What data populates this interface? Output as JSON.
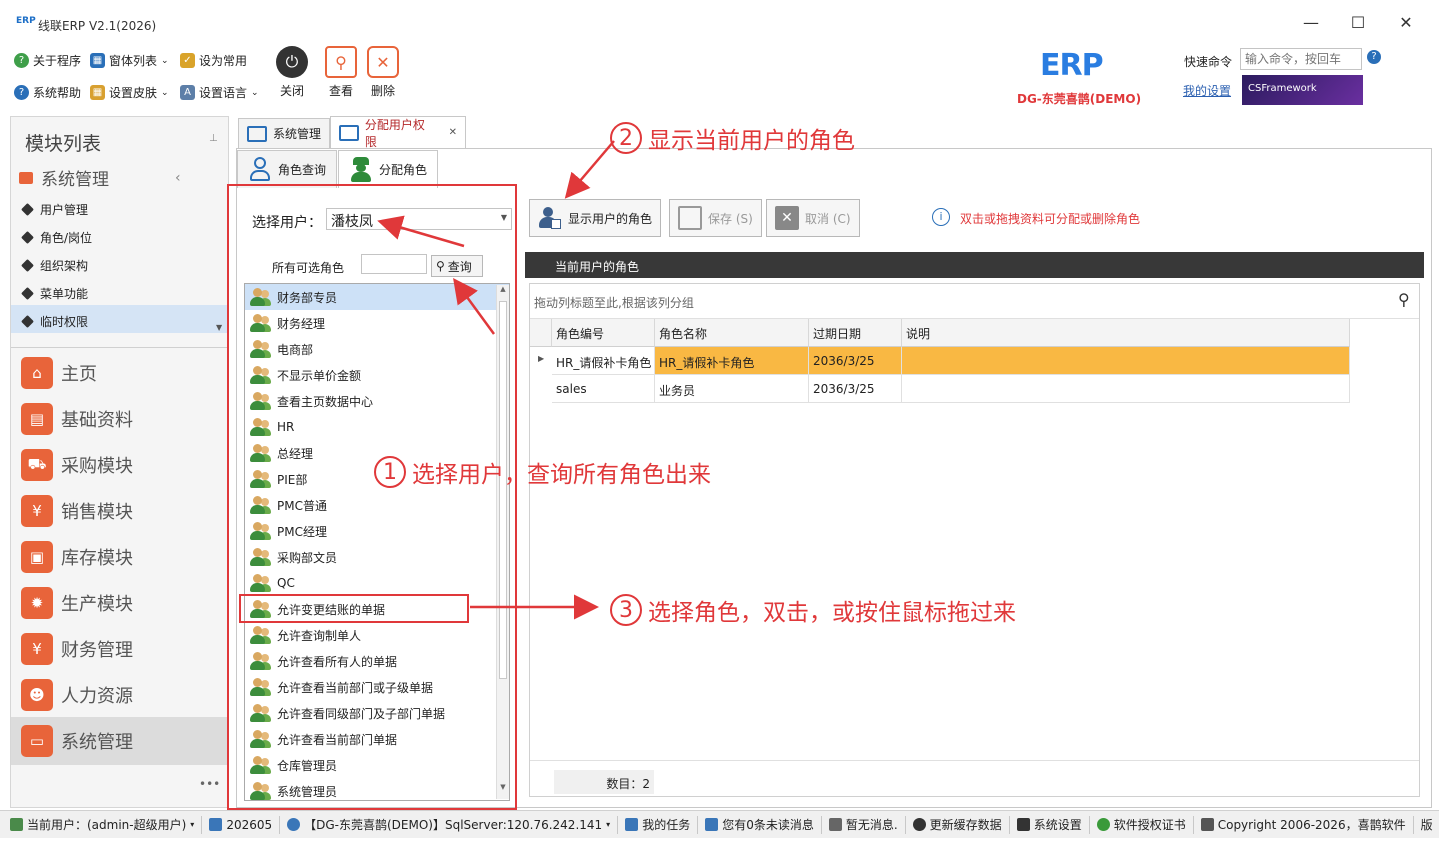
{
  "window": {
    "title": "线联ERP V2.1(2026)",
    "icon_text": "ERP",
    "min": "—",
    "max": "☐",
    "close": "✕"
  },
  "ribbon": {
    "small_items": [
      "关于程序",
      "窗体列表",
      "设为常用",
      "系统帮助",
      "设置皮肤",
      "设置语言"
    ],
    "big_buttons": [
      "关闭",
      "查看",
      "删除"
    ],
    "logo_text": "ERP",
    "company": "DG-东莞喜鹊(DEMO)",
    "quick_cmd_label": "快速命令",
    "quick_cmd_placeholder": "输入命令，按回车",
    "my_settings": "我的设置",
    "cs_framework": "CSFramework",
    "help_icon": "?"
  },
  "left_panel": {
    "title": "模块列表",
    "group": "系统管理",
    "sub_items": [
      "用户管理",
      "角色/岗位",
      "组织架构",
      "菜单功能",
      "临时权限"
    ],
    "modules": [
      "主页",
      "基础资料",
      "采购模块",
      "销售模块",
      "库存模块",
      "生产模块",
      "财务管理",
      "人力资源",
      "系统管理"
    ],
    "more": "•••"
  },
  "tabs": {
    "main": [
      "系统管理",
      "分配用户权限"
    ],
    "sub": [
      "角色查询",
      "分配角色"
    ],
    "close": "✕"
  },
  "role_panel": {
    "select_user_label": "选择用户：",
    "select_user_value": "潘枝凤",
    "all_roles_label": "所有可选角色",
    "search_button": "查询",
    "roles": [
      "财务部专员",
      "财务经理",
      "电商部",
      "不显示单价金额",
      "查看主页数据中心",
      "HR",
      "总经理",
      "PIE部",
      "PMC普通",
      "PMC经理",
      "采购部文员",
      "QC",
      "允许变更结账的单据",
      "允许查询制单人",
      "允许查看所有人的单据",
      "允许查看当前部门或子级单据",
      "允许查看同级部门及子部门单据",
      "允许查看当前部门单据",
      "仓库管理员",
      "系统管理员"
    ]
  },
  "toolbar": {
    "show_roles": "显示用户的角色",
    "save": "保存 (S)",
    "cancel": "取消 (C)",
    "hint": "双击或拖拽资料可分配或删除角色"
  },
  "grid": {
    "section_title": "当前用户的角色",
    "group_hint": "拖动列标题至此,根据该列分组",
    "columns": [
      "角色编号",
      "角色名称",
      "过期日期",
      "说明"
    ],
    "rows": [
      {
        "code": "HR_请假补卡角色",
        "name": "HR_请假补卡角色",
        "expire": "2036/3/25",
        "note": ""
      },
      {
        "code": "sales",
        "name": "业务员",
        "expire": "2036/3/25",
        "note": ""
      }
    ],
    "count_label": "数目：2"
  },
  "annotations": {
    "one": {
      "num": "1",
      "text": "选择用户，查询所有角色出来"
    },
    "two": {
      "num": "2",
      "text": "显示当前用户的角色"
    },
    "three": {
      "num": "3",
      "text": "选择角色，双击，或按住鼠标拖过来"
    }
  },
  "status_bar": [
    "当前用户：(admin-超级用户)",
    "202605",
    "【DG-东莞喜鹊(DEMO)】SqlServer:120.76.242.141",
    "我的任务",
    "您有0条未读消息",
    "暂无消息.",
    "更新缓存数据",
    "系统设置",
    "软件授权证书",
    "Copyright 2006-2026，喜鹊软件",
    "版"
  ],
  "colors": {
    "accent_red": "#e0383a",
    "selected_row": "#f9b843",
    "grid_header": "#383838",
    "module_icon": "#e8643a"
  }
}
